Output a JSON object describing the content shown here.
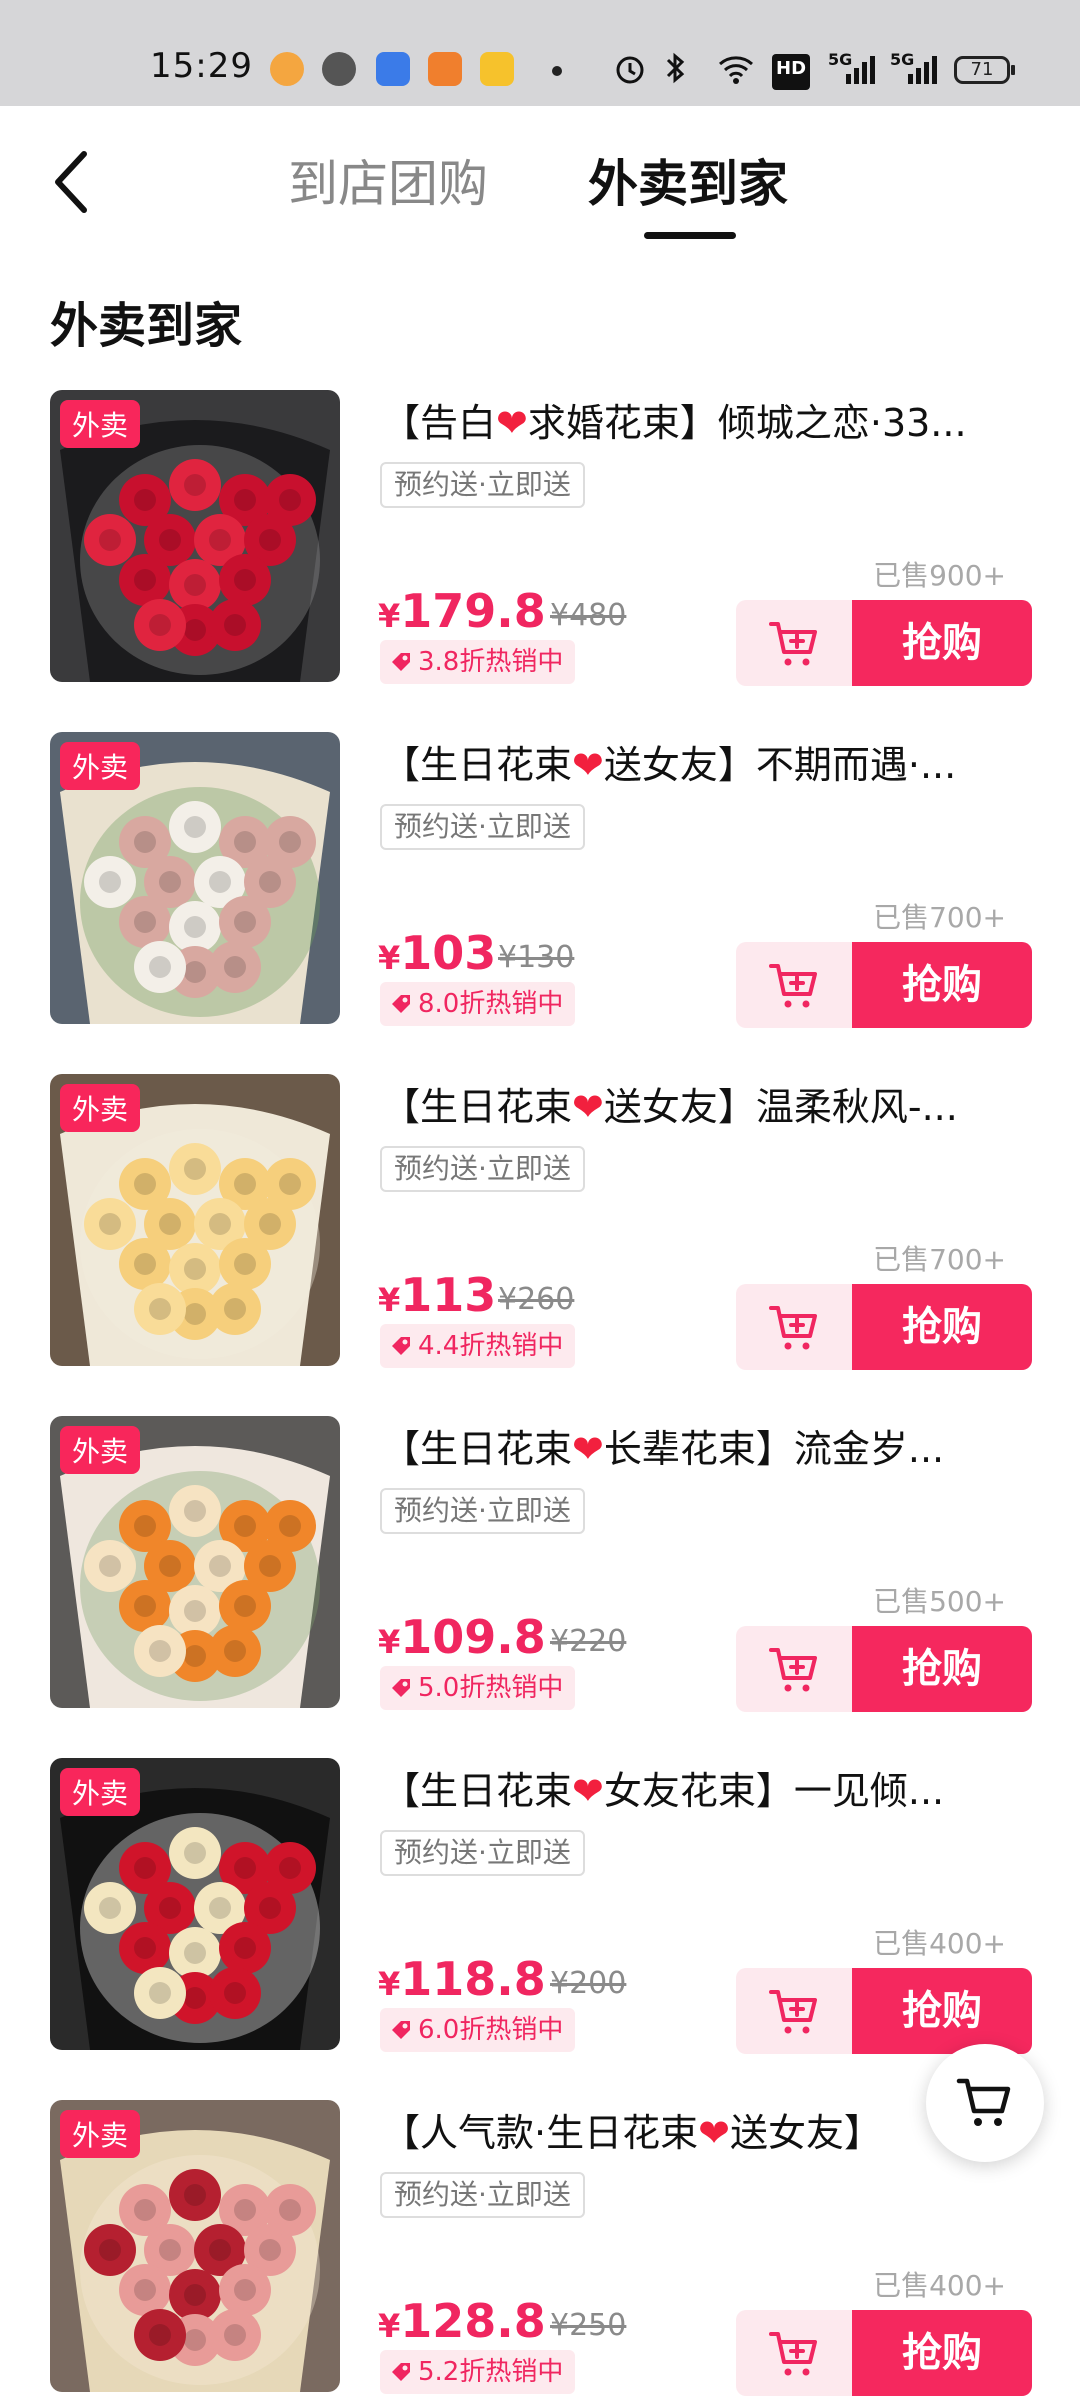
{
  "status_bar": {
    "time": "15:29",
    "network": "HD",
    "signal_1": "5G",
    "signal_2": "5G",
    "battery": "71"
  },
  "header": {
    "tabs": [
      {
        "label": "到店团购",
        "active": false
      },
      {
        "label": "外卖到家",
        "active": true
      }
    ]
  },
  "section_title": "外卖到家",
  "badge_label": "外卖",
  "tag_label": "预约送·立即送",
  "buy_label": "抢购",
  "colors": {
    "accent": "#f5285e",
    "badge": "#f8265b",
    "price": "#f02660",
    "heart": "#f2203e"
  },
  "products": [
    {
      "title_pre": "【告白",
      "title_post": "求婚花束】倾城之恋·33...",
      "sold": "已售900+",
      "yen": "¥",
      "price": "179.8",
      "original": "¥480",
      "discount": "3.8折热销中",
      "image_theme": "red-roses-black-wrap"
    },
    {
      "title_pre": "【生日花束",
      "title_post": "送女友】不期而遇·...",
      "sold": "已售700+",
      "yen": "¥",
      "price": "103",
      "original": "¥130",
      "discount": "8.0折热销中",
      "image_theme": "pink-roses-cream-wrap"
    },
    {
      "title_pre": "【生日花束",
      "title_post": "送女友】温柔秋风-...",
      "sold": "已售700+",
      "yen": "¥",
      "price": "113",
      "original": "¥260",
      "discount": "4.4折热销中",
      "image_theme": "champagne-roses"
    },
    {
      "title_pre": "【生日花束",
      "title_post": "长辈花束】流金岁...",
      "sold": "已售500+",
      "yen": "¥",
      "price": "109.8",
      "original": "¥220",
      "discount": "5.0折热销中",
      "image_theme": "orange-mixed-bouquet"
    },
    {
      "title_pre": "【生日花束",
      "title_post": "女友花束】一见倾...",
      "sold": "已售400+",
      "yen": "¥",
      "price": "118.8",
      "original": "¥200",
      "discount": "6.0折热销中",
      "image_theme": "red-roses-lights"
    },
    {
      "title_pre": "【人气款·生日花束",
      "title_post": "送女友】",
      "sold": "已售400+",
      "yen": "¥",
      "price": "128.8",
      "original": "¥250",
      "discount": "5.2折热销中",
      "image_theme": "pink-roses-gold-wrap"
    }
  ]
}
